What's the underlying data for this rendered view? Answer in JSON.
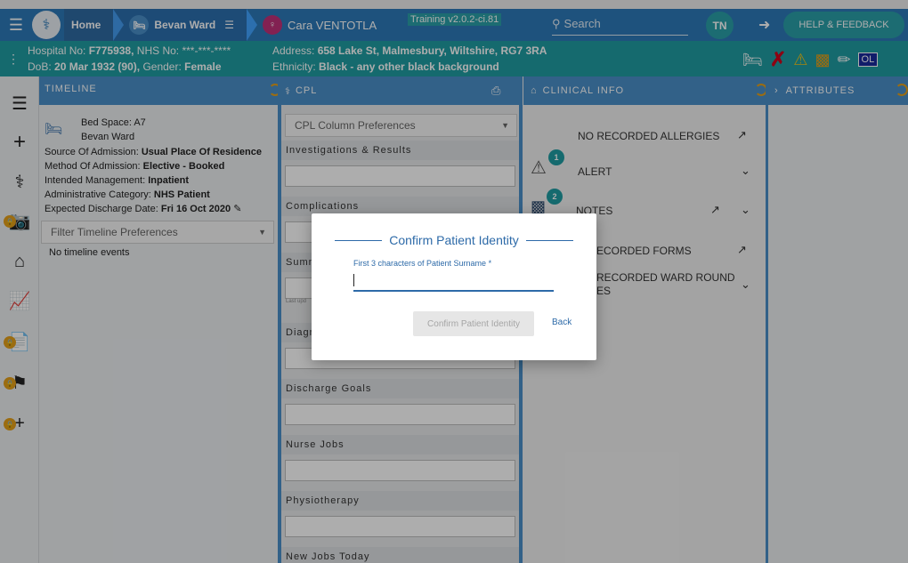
{
  "topbar": {
    "home_label": "Home",
    "ward_label": "Bevan Ward",
    "patient_label": "Cara VENTOTLA",
    "training_badge": "Training v2.0.2-ci.81",
    "search_placeholder": "Search",
    "user_initials": "TN",
    "help_label": "HELP & FEEDBACK"
  },
  "banner": {
    "hospital_no_label": "Hospital No:",
    "hospital_no": "F775938,",
    "nhs_no_label": "NHS No:",
    "nhs_no": "***-***-****",
    "dob_label": "DoB:",
    "dob": "20 Mar 1932 (90),",
    "gender_label": "Gender:",
    "gender": "Female",
    "address_label": "Address:",
    "address": "658 Lake St, Malmesbury, Wiltshire, RG7 3RA",
    "ethnicity_label": "Ethnicity:",
    "ethnicity": "Black - any other black background",
    "ol_badge": "OL"
  },
  "columns": {
    "timeline": "TIMELINE",
    "cpl": "CPL",
    "clinical": "CLINICAL INFO",
    "attributes": "ATTRIBUTES"
  },
  "timeline": {
    "bed_space": "Bed Space: A7",
    "ward": "Bevan Ward",
    "source_label": "Source Of Admission:",
    "source": "Usual Place Of Residence",
    "method_label": "Method Of Admission:",
    "method": "Elective - Booked",
    "management_label": "Intended Management:",
    "management": "Inpatient",
    "category_label": "Administrative Category:",
    "category": "NHS Patient",
    "discharge_label": "Expected Discharge Date:",
    "discharge": "Fri 16 Oct 2020",
    "filter_placeholder": "Filter Timeline Preferences",
    "empty": "No timeline events"
  },
  "cpl": {
    "prefs_placeholder": "CPL Column Preferences",
    "sections": [
      "Investigations & Results",
      "Complications",
      "Summ",
      "Diagn",
      "Discharge Goals",
      "Nurse Jobs",
      "Physiotherapy",
      "New Jobs Today"
    ],
    "last_updated": "Last upd"
  },
  "clinical": {
    "allergies": "NO RECORDED ALLERGIES",
    "alert": "ALERT",
    "alert_count": "1",
    "notes": "NOTES",
    "notes_count": "2",
    "forms": "ECORDED FORMS",
    "ward_round_1": "RECORDED WARD ROUND",
    "ward_round_2": "ES"
  },
  "modal": {
    "title": "Confirm Patient Identity",
    "input_label": "First 3 characters of Patient Surname *",
    "confirm_label": "Confirm Patient Identity",
    "back_label": "Back"
  }
}
